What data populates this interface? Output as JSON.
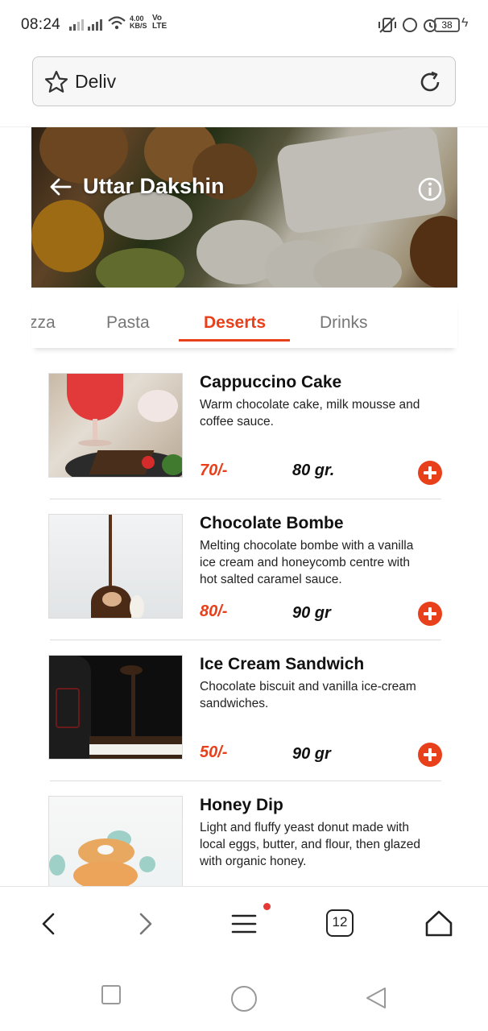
{
  "status_bar": {
    "time": "08:24",
    "speed_value": "4.00",
    "speed_unit": "KB/S",
    "network_top": "Vo",
    "network_bottom": "LTE",
    "battery": "38"
  },
  "url_bar": {
    "text": "Deliv"
  },
  "restaurant": {
    "name": "Uttar Dakshin"
  },
  "tabs": [
    {
      "label": "zza"
    },
    {
      "label": "Pasta"
    },
    {
      "label": "Deserts"
    },
    {
      "label": "Drinks"
    }
  ],
  "active_tab": "Deserts",
  "items": [
    {
      "name": "Cappuccino Cake",
      "description": "Warm chocolate cake, milk mousse and coffee sauce.",
      "price": "70/-",
      "weight": "80 gr."
    },
    {
      "name": "Chocolate Bombe",
      "description": "Melting chocolate bombe with a vanilla ice cream and honeycomb centre with hot salted caramel sauce.",
      "price": "80/-",
      "weight": "90 gr"
    },
    {
      "name": "Ice Cream Sandwich",
      "description": "Chocolate biscuit and vanilla ice-cream sandwiches.",
      "price": "50/-",
      "weight": "90 gr"
    },
    {
      "name": "Honey Dip",
      "description": "Light and fluffy yeast donut made with local eggs, butter, and flour, then glazed with organic honey.",
      "price": "",
      "weight": ""
    }
  ],
  "browser_nav": {
    "tab_count": "12"
  },
  "colors": {
    "accent": "#e8401b",
    "notification_dot": "#e53935"
  },
  "icons": [
    "star-icon",
    "reload-icon",
    "back-arrow-icon",
    "info-icon",
    "add-icon",
    "chevron-left-icon",
    "chevron-right-icon",
    "menu-icon",
    "tabs-icon",
    "home-icon",
    "recents-icon",
    "circle-home-icon",
    "triangle-back-icon"
  ]
}
